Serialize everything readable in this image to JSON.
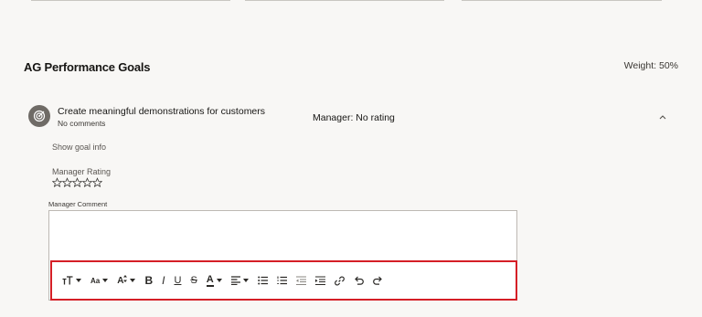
{
  "section": {
    "title": "AG Performance Goals",
    "weight": "Weight: 50%"
  },
  "goal": {
    "name": "Create meaningful demonstrations for customers",
    "comments": "No comments",
    "manager_rating_summary": "Manager: No rating",
    "show_goal_info": "Show goal info",
    "icon": "goal-target-icon"
  },
  "rating": {
    "label": "Manager Rating",
    "stars_total": 5,
    "stars_filled": 0
  },
  "comment": {
    "label": "Manager Comment",
    "value": ""
  },
  "toolbar": {
    "items": [
      "font-size-icon",
      "font-family-icon",
      "text-size-adjust-icon",
      "bold-icon",
      "italic-icon",
      "underline-icon",
      "strikethrough-icon",
      "font-color-icon",
      "align-icon",
      "bullet-list-icon",
      "numbered-list-icon",
      "outdent-icon",
      "indent-icon",
      "link-icon",
      "undo-icon",
      "redo-icon"
    ],
    "bold": "B",
    "italic": "I",
    "underline": "U",
    "strike": "S",
    "font_color": "A",
    "text_size": "A",
    "font_family": "Aa"
  },
  "colors": {
    "highlight": "#d51f26",
    "icon": "#2b2926",
    "background": "#f8f7f5"
  }
}
